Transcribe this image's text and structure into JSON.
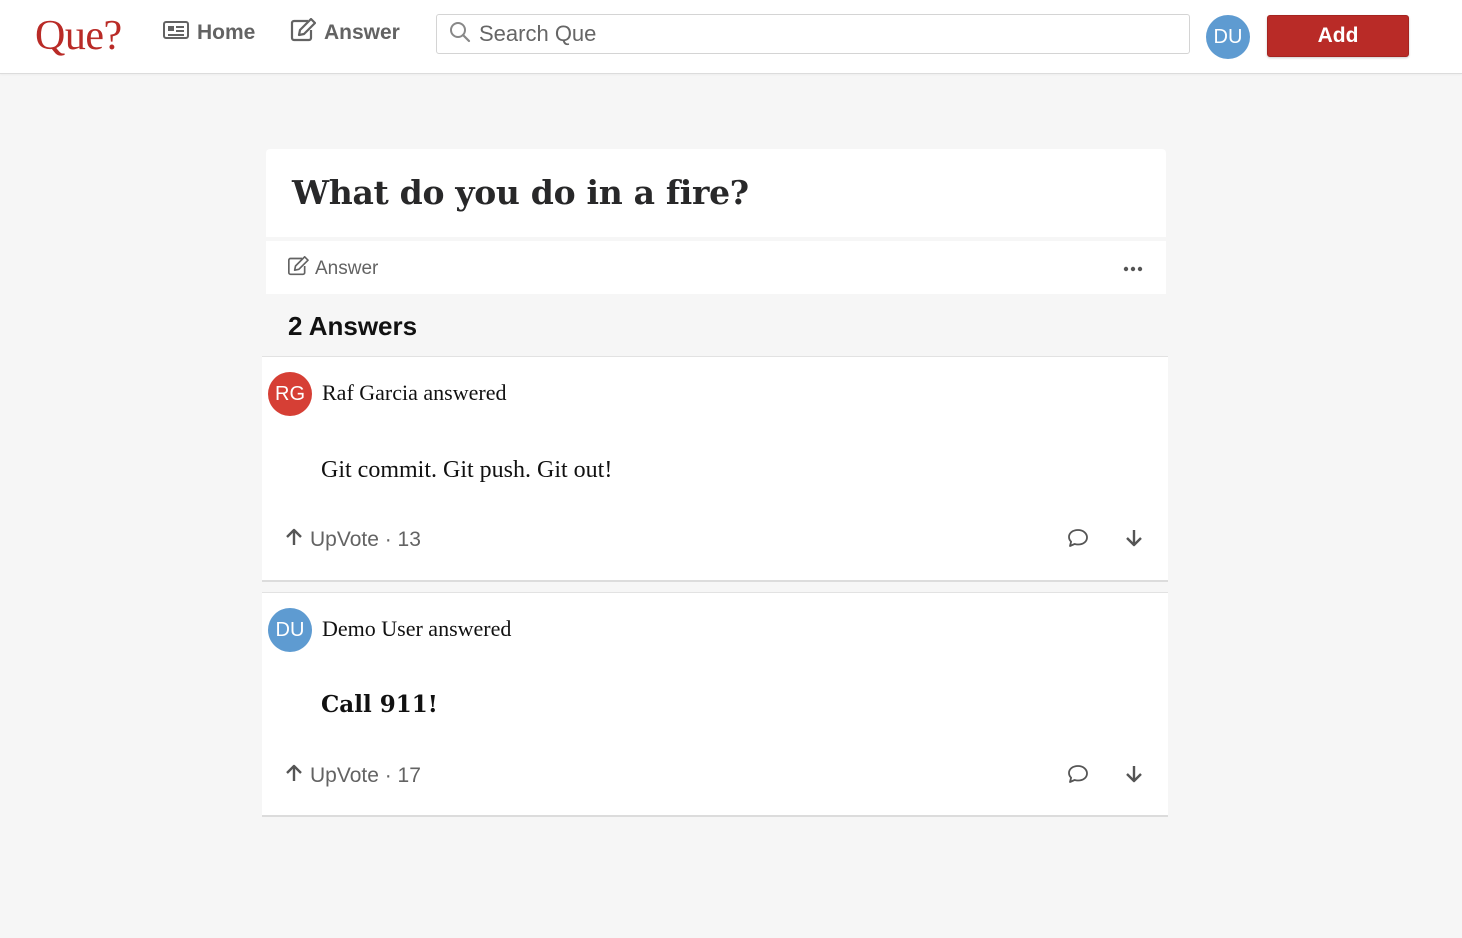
{
  "header": {
    "logo": "Que?",
    "nav": {
      "home": "Home",
      "answer": "Answer"
    },
    "search": {
      "placeholder": "Search Que"
    },
    "user_initials": "DU",
    "add_label": "Add",
    "colors": {
      "brand": "#b92b27",
      "avatar": "#5e9bd1"
    }
  },
  "question": {
    "title": "What do you do in a fire?",
    "answer_action": "Answer",
    "more_icon": "ellipsis-icon"
  },
  "answers_heading": "2 Answers",
  "answers": [
    {
      "initials": "RG",
      "avatar_color": "#d63f35",
      "author": "Raf Garcia answered",
      "body": "Git commit. Git push. Git out!",
      "upvote": "UpVote · 13"
    },
    {
      "initials": "DU",
      "avatar_color": "#5e9bd1",
      "author": "Demo User answered",
      "body": "Call 911!",
      "upvote": "UpVote · 17"
    }
  ]
}
